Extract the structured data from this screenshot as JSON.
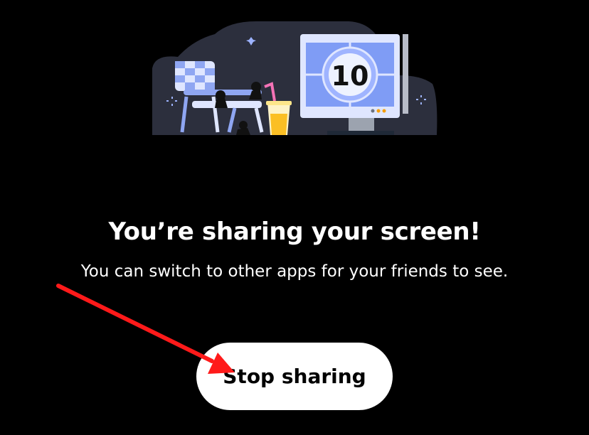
{
  "screen_share": {
    "title": "You’re sharing your screen!",
    "subtitle": "You can switch to other apps for your friends to see.",
    "stop_button_label": "Stop sharing",
    "tv_countdown": "10"
  },
  "colors": {
    "background": "#000000",
    "illustration_bg": "#2c2f3d",
    "accent_blue": "#7f9cf5",
    "button_bg": "#ffffff",
    "annotation_arrow": "#ff1a1a",
    "juice": "#fbbf24"
  },
  "icons": [
    "sparkle-icon",
    "tv-icon",
    "lawn-chair-icon",
    "drink-icon",
    "annotation-arrow"
  ]
}
